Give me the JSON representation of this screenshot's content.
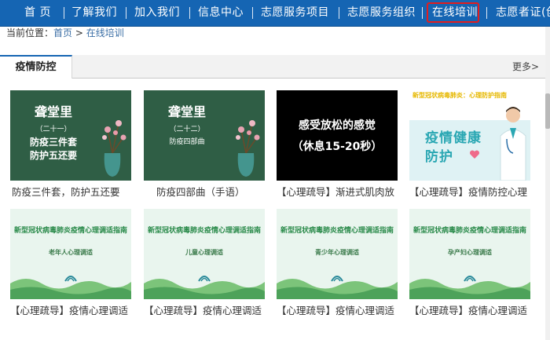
{
  "nav": {
    "items": [
      "首 页",
      "了解我们",
      "加入我们",
      "信息中心",
      "志愿服务项目",
      "志愿服务组织",
      "在线培训",
      "志愿者证(创"
    ],
    "active_index": 6,
    "colors": {
      "bar": "#1565b3",
      "highlight": "#e41d1d"
    }
  },
  "breadcrumb": {
    "prefix": "当前位置：",
    "home": "首页",
    "sep": ">",
    "current": "在线培训"
  },
  "tabbar": {
    "active_tab": "疫情防控",
    "more": "更多>"
  },
  "cards": [
    {
      "caption": "防疫三件套，防护五还要",
      "thumb": {
        "title": "聋堂里",
        "episode": "（二十一）",
        "line1": "防疫三件套",
        "line2": "防护五还要"
      }
    },
    {
      "caption": "防疫四部曲（手语）",
      "thumb": {
        "title": "聋堂里",
        "episode": "（二十二）",
        "line1": "防疫四部曲"
      }
    },
    {
      "caption": "【心理疏导】渐进式肌肉放",
      "thumb": {
        "line1": "感受放松的感觉",
        "line2": "（休息15-20秒）"
      }
    },
    {
      "caption": "【心理疏导】疫情防控心理",
      "thumb": {
        "banner": "新型冠状病毒肺炎：心理防护指南",
        "line1": "疫情健康",
        "line2": "防护"
      }
    },
    {
      "caption": "【心理疏导】疫情心理调适",
      "thumb": {
        "title": "新型冠状病毒肺炎疫情心理调适指南",
        "subtitle": "老年人心理调适"
      }
    },
    {
      "caption": "【心理疏导】疫情心理调适",
      "thumb": {
        "title": "新型冠状病毒肺炎疫情心理调适指南",
        "subtitle": "儿童心理调适"
      }
    },
    {
      "caption": "【心理疏导】疫情心理调适",
      "thumb": {
        "title": "新型冠状病毒肺炎疫情心理调适指南",
        "subtitle": "青少年心理调适"
      }
    },
    {
      "caption": "【心理疏导】疫情心理调适",
      "thumb": {
        "title": "新型冠状病毒肺炎疫情心理调适指南",
        "subtitle": "孕产妇心理调适"
      }
    }
  ]
}
